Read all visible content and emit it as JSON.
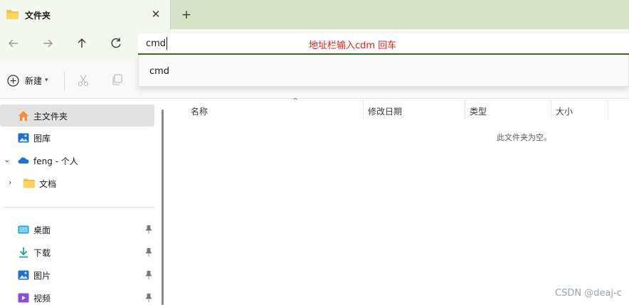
{
  "tab": {
    "title": "文件夹",
    "close_icon": "close-icon",
    "new_tab_icon": "plus-icon"
  },
  "nav": {
    "back_icon": "arrow-left-icon",
    "forward_icon": "arrow-right-icon",
    "up_icon": "arrow-up-icon",
    "refresh_icon": "refresh-icon",
    "address_value": "cmd",
    "annotation": "地址栏输入cdm 回车"
  },
  "suggestion": {
    "item": "cmd"
  },
  "command_bar": {
    "new_label": "新建",
    "new_icon": "plus-circle-icon",
    "cut_icon": "scissors-icon",
    "copy_icon": "copy-icon"
  },
  "sidebar": {
    "items": [
      {
        "label": "主文件夹",
        "icon": "home-icon",
        "selected": true
      },
      {
        "label": "图库",
        "icon": "gallery-icon"
      },
      {
        "label": "feng - 个人",
        "icon": "onedrive-cloud-icon",
        "expanded": true
      },
      {
        "label": "文档",
        "icon": "folder-icon",
        "expanded": false
      }
    ],
    "quick_access": [
      {
        "label": "桌面",
        "icon": "desktop-icon"
      },
      {
        "label": "下载",
        "icon": "download-icon"
      },
      {
        "label": "图片",
        "icon": "pictures-icon"
      },
      {
        "label": "视频",
        "icon": "video-icon"
      }
    ]
  },
  "content": {
    "columns": [
      "名称",
      "修改日期",
      "类型",
      "大小"
    ],
    "empty_message": "此文件夹为空。"
  },
  "watermark": "CSDN @deaj-c",
  "colors": {
    "accent_green": "#3c6a23",
    "annotation_red": "#e02020",
    "tabstrip": "#d6e2c6"
  }
}
